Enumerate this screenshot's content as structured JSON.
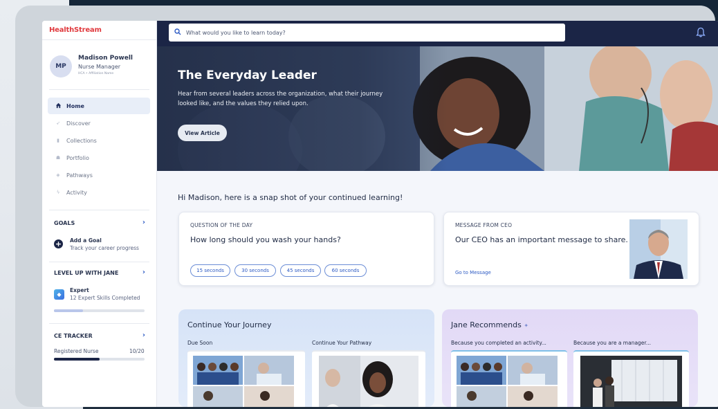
{
  "app": {
    "logo_bold": "HealthStream",
    "logo_light": ""
  },
  "user": {
    "initials": "MP",
    "name": "Madison Powell",
    "role": "Nurse Manager",
    "subtitle": "HCA • Affiliation Name"
  },
  "nav": {
    "items": [
      {
        "label": "Home",
        "icon": "home-icon",
        "active": true
      },
      {
        "label": "Discover",
        "icon": "discover-icon",
        "active": false
      },
      {
        "label": "Collections",
        "icon": "collections-icon",
        "active": false
      },
      {
        "label": "Portfolio",
        "icon": "portfolio-icon",
        "active": false
      },
      {
        "label": "Pathways",
        "icon": "pathways-icon",
        "active": false
      },
      {
        "label": "Activity",
        "icon": "activity-icon",
        "active": false
      }
    ]
  },
  "goals": {
    "heading": "GOALS",
    "add_title": "Add a Goal",
    "add_sub": "Track your career progress"
  },
  "level_up": {
    "heading": "LEVEL UP WITH JANE",
    "title": "Expert",
    "sub": "12 Expert Skills Completed",
    "progress": 0.32
  },
  "ce_tracker": {
    "heading": "CE TRACKER",
    "label": "Registered Nurse",
    "count": "10/20",
    "progress": 0.5
  },
  "search": {
    "placeholder": "What would you like to learn today?"
  },
  "hero": {
    "title": "The Everyday Leader",
    "description": "Hear from several leaders across the organization, what their journey looked like, and the values they relied upon.",
    "button": "View Article"
  },
  "greeting": "Hi Madison, here is a snap shot of your continued learning!",
  "question_card": {
    "kicker": "QUESTION OF THE DAY",
    "question": "How long should you wash your hands?",
    "options": [
      "15 seconds",
      "30 seconds",
      "45 seconds",
      "60 seconds"
    ]
  },
  "ceo_card": {
    "kicker": "MESSAGE FROM CEO",
    "message": "Our CEO has an important message to share.",
    "link": "Go to Message"
  },
  "journey": {
    "title": "Continue Your Journey",
    "sub_left": "Due Soon",
    "sub_right": "Continue Your Pathway"
  },
  "recommends": {
    "title": "Jane Recommends",
    "sub_left": "Because you completed an activity...",
    "sub_right": "Because you are a manager..."
  },
  "colors": {
    "navy": "#1b2546",
    "accent_blue": "#2b59c3",
    "brand_red": "#e03a3e"
  }
}
